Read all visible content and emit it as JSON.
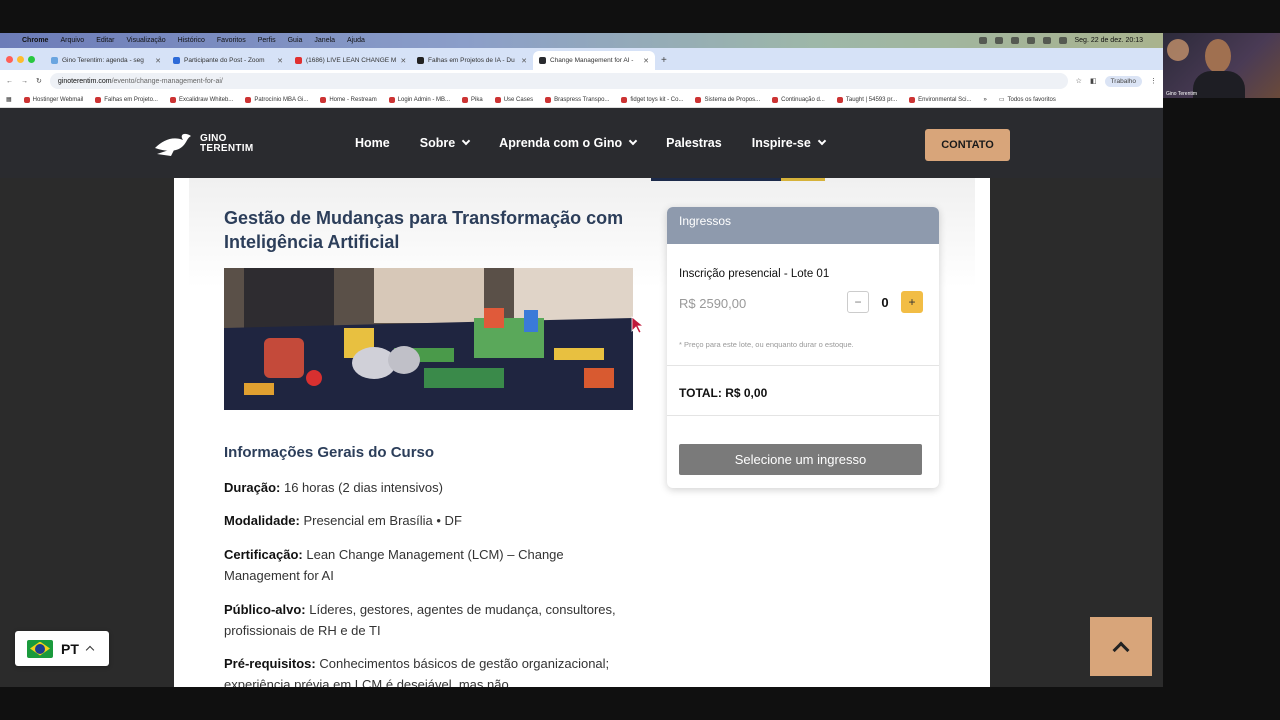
{
  "menubar": {
    "items": [
      "Chrome",
      "Arquivo",
      "Editar",
      "Visualização",
      "Histórico",
      "Favoritos",
      "Perfis",
      "Guia",
      "Janela",
      "Ajuda"
    ],
    "clock": "Seg. 22 de dez.  20:13"
  },
  "tabs": [
    {
      "label": "Gino Terentim: agenda - seg",
      "color": "#6aa5e0",
      "active": false
    },
    {
      "label": "Participante do Post - Zoom",
      "color": "#2d6ad8",
      "active": false
    },
    {
      "label": "(1686) LIVE LEAN CHANGE M",
      "color": "#e03030",
      "active": false
    },
    {
      "label": "Falhas em Projetos de IA - Du",
      "color": "#222222",
      "active": false
    },
    {
      "label": "Change Management for AI -",
      "color": "#2a2b2f",
      "active": true
    }
  ],
  "address": {
    "domain": "ginoterentim.com",
    "path": "/evento/change-management-for-ai/",
    "profile": "Trabalho"
  },
  "bookmarks": [
    "Hostinger Webmail",
    "Falhas em Projeto...",
    "Excalidraw Whiteb...",
    "Patrocínio MBA Gi...",
    "Home - Restream",
    "Login Admin - MB...",
    "Pika",
    "Use Cases",
    "Braspress Transpo...",
    "fidget toys kit - Co...",
    "Sistema de Propos...",
    "Continuação d...",
    "Taught | 54593 pr...",
    "Environmental Sci..."
  ],
  "bookmarks_folder": "Todos os favoritos",
  "webcam": {
    "name": "Gino Terentim"
  },
  "site": {
    "logo_line1": "GINO",
    "logo_line2": "TERENTIM",
    "nav": {
      "home": "Home",
      "sobre": "Sobre",
      "aprenda": "Aprenda com o Gino",
      "palestras": "Palestras",
      "inspire": "Inspire-se"
    },
    "contact_button": "CONTATO"
  },
  "event": {
    "title": "Gestão de Mudanças para Transformação com Inteligência Artificial",
    "section_heading": "Informações Gerais do Curso",
    "info": [
      {
        "label": "Duração:",
        "value": " 16 horas (2 dias intensivos)"
      },
      {
        "label": "Modalidade:",
        "value": " Presencial em Brasília • DF"
      },
      {
        "label": "Certificação:",
        "value": " Lean Change Management (LCM) – Change Management for AI"
      },
      {
        "label": "Público-alvo:",
        "value": " Líderes, gestores, agentes de mudança, consultores, profissionais de RH e de TI"
      },
      {
        "label": "Pré-requisitos:",
        "value": " Conhecimentos básicos de gestão organizacional; experiência prévia em LCM é desejável, mas não"
      }
    ]
  },
  "tickets": {
    "header": "Ingressos",
    "lot_name": "Inscrição presencial - Lote 01",
    "price": "R$ 2590,00",
    "quantity": "0",
    "minus": "−",
    "plus": "+",
    "note": "* Preço para este lote, ou enquanto durar o estoque.",
    "total": "TOTAL: R$ 0,00",
    "select_button": "Selecione um ingresso"
  },
  "language": {
    "code": "PT"
  },
  "colors": {
    "accent": "#d8a57a",
    "plus": "#f2bd45",
    "heading": "#2c3e5a",
    "card_header": "#8e9aad"
  }
}
